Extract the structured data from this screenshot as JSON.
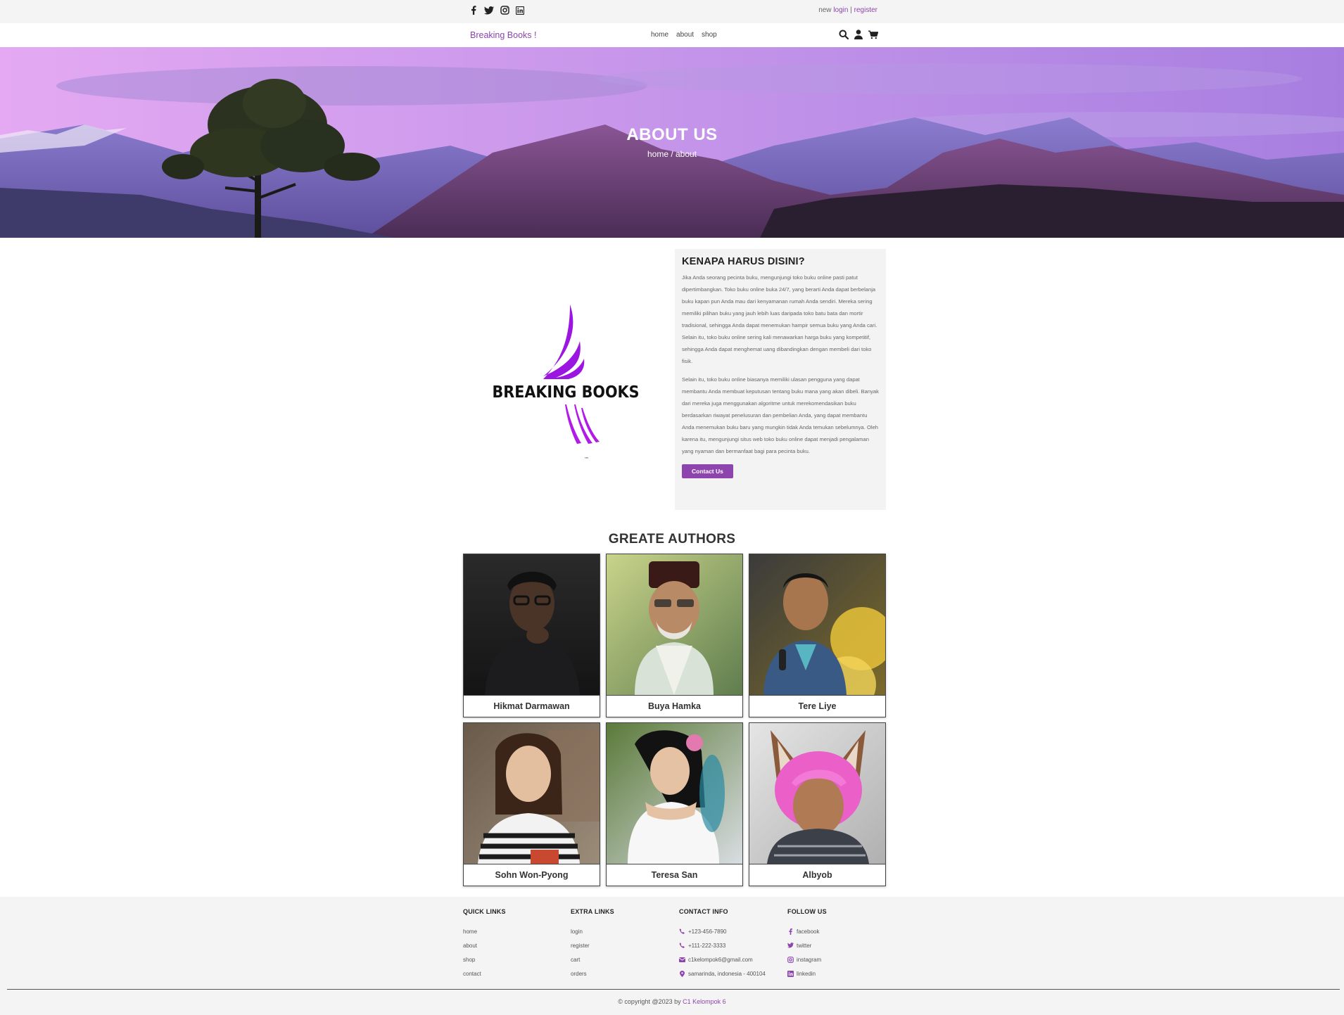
{
  "topbar": {
    "social": [
      "facebook-icon",
      "twitter-icon",
      "instagram-icon",
      "linkedin-icon"
    ],
    "auth_prefix": "new",
    "login": "login",
    "separator": "|",
    "register": "register"
  },
  "navbar": {
    "brand": "Breaking Books !",
    "links": [
      "home",
      "about",
      "shop"
    ],
    "icons": [
      "search-icon",
      "user-icon",
      "cart-icon"
    ]
  },
  "hero": {
    "title": "ABOUT US",
    "breadcrumb": "home / about"
  },
  "about": {
    "logo_text": "BREAKING BOOKS",
    "heading": "KENAPA HARUS DISINI?",
    "paragraph1": "Jika Anda seorang pecinta buku, mengunjungi toko buku online pasti patut dipertimbangkan. Toko buku online buka 24/7, yang berarti Anda dapat berbelanja buku kapan pun Anda mau dari kenyamanan rumah Anda sendiri. Mereka sering memiliki pilihan buku yang jauh lebih luas daripada toko batu bata dan mortir tradisional, sehingga Anda dapat menemukan hampir semua buku yang Anda cari. Selain itu, toko buku online sering kali menawarkan harga buku yang kompetitif, sehingga Anda dapat menghemat uang dibandingkan dengan membeli dari toko fisik.",
    "paragraph2": "Selain itu, toko buku online biasanya memiliki ulasan pengguna yang dapat membantu Anda membuat keputusan tentang buku mana yang akan dibeli. Banyak dari mereka juga menggunakan algoritme untuk merekomendasikan buku berdasarkan riwayat penelusuran dan pembelian Anda, yang dapat membantu Anda menemukan buku baru yang mungkin tidak Anda temukan sebelumnya. Oleh karena itu, mengunjungi situs web toko buku online dapat menjadi pengalaman yang nyaman dan bermanfaat bagi para pecinta buku.",
    "button": "Contact Us"
  },
  "authors": {
    "title": "GREATE AUTHORS",
    "items": [
      {
        "name": "Hikmat Darmawan"
      },
      {
        "name": "Buya Hamka"
      },
      {
        "name": "Tere Liye"
      },
      {
        "name": "Sohn Won-Pyong"
      },
      {
        "name": "Teresa San"
      },
      {
        "name": "Albyob"
      }
    ]
  },
  "footer": {
    "quick": {
      "title": "QUICK LINKS",
      "links": [
        "home",
        "about",
        "shop",
        "contact"
      ]
    },
    "extra": {
      "title": "EXTRA LINKS",
      "links": [
        "login",
        "register",
        "cart",
        "orders"
      ]
    },
    "contact": {
      "title": "CONTACT INFO",
      "items": [
        "+123-456-7890",
        "+111-222-3333",
        "c1kelompok6@gmail.com",
        "samarinda, indonesia - 400104"
      ]
    },
    "follow": {
      "title": "FOLLOW US",
      "items": [
        "facebook",
        "twitter",
        "instagram",
        "linkedin"
      ]
    },
    "copyright": "© copyright @2023 by",
    "copyright_owner": "C1 Kelompok 6"
  },
  "colors": {
    "accent": "#8e44ad",
    "footer_bg": "#f4f4f4",
    "topbar_bg": "#f4f4f4"
  }
}
